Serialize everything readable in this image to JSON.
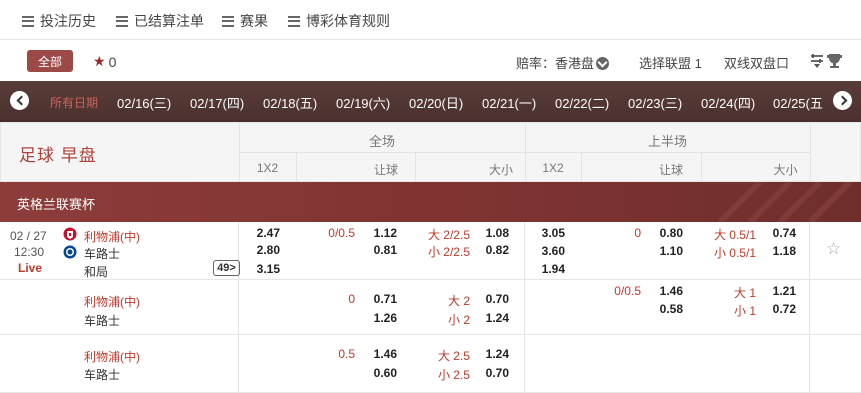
{
  "nav": {
    "items": [
      {
        "label": "投注历史"
      },
      {
        "label": "已结算注单"
      },
      {
        "label": "赛果"
      },
      {
        "label": "博彩体育规则"
      }
    ]
  },
  "toolbar": {
    "all_label": "全部",
    "star_count": "0",
    "odds_label": "赔率：香港盘",
    "league_label": "选择联盟 1",
    "double_label": "双线双盘口"
  },
  "dates": {
    "items": [
      "所有日期",
      "02/16(三)",
      "02/17(四)",
      "02/18(五)",
      "02/19(六)",
      "02/20(日)",
      "02/21(一)",
      "02/22(二)",
      "02/23(三)",
      "02/24(四)",
      "02/25(五"
    ],
    "active_index": 0
  },
  "header": {
    "title": "足球 早盘",
    "full_label": "全场",
    "half_label": "上半场",
    "col_1x2": "1X2",
    "col_hdp": "让球",
    "col_ou": "大小"
  },
  "league": {
    "name": "英格兰联赛杯"
  },
  "match": {
    "date": "02 / 27",
    "time": "12:30",
    "live": "Live",
    "home": "利物浦",
    "home_tag": "(中)",
    "away": "车路士",
    "draw": "和局",
    "more": "49>",
    "rows": [
      {
        "ft_1x2": [
          "2.47",
          "2.80",
          "3.15"
        ],
        "ft_hdp_line": "0/0.5",
        "ft_hdp_odds": [
          "1.12",
          "0.81"
        ],
        "ft_ou_lines": [
          "大 2/2.5",
          "小 2/2.5"
        ],
        "ft_ou_odds": [
          "1.08",
          "0.82"
        ],
        "ht_1x2": [
          "3.05",
          "3.60",
          "1.94"
        ],
        "ht_hdp_line": "0",
        "ht_hdp_odds": [
          "0.80",
          "1.10"
        ],
        "ht_ou_lines": [
          "大 0.5/1",
          "小 0.5/1"
        ],
        "ht_ou_odds": [
          "0.74",
          "1.18"
        ]
      },
      {
        "ft_hdp_line": "0",
        "ft_hdp_odds": [
          "0.71",
          "1.26"
        ],
        "ft_ou_lines": [
          "大 2",
          "小 2"
        ],
        "ft_ou_odds": [
          "0.70",
          "1.24"
        ],
        "ht_hdp_line": "0/0.5",
        "ht_hdp_odds": [
          "1.46",
          "0.58"
        ],
        "ht_ou_lines": [
          "大 1",
          "小 1"
        ],
        "ht_ou_odds": [
          "1.21",
          "0.72"
        ]
      },
      {
        "ft_hdp_line": "0.5",
        "ft_hdp_odds": [
          "1.46",
          "0.60"
        ],
        "ft_ou_lines": [
          "大 2.5",
          "小 2.5"
        ],
        "ft_ou_odds": [
          "1.24",
          "0.70"
        ]
      }
    ]
  },
  "colors": {
    "accent": "#9b4a48",
    "datebar": "#4f3532",
    "league": "#843735",
    "odds_red": "#c0392b"
  }
}
